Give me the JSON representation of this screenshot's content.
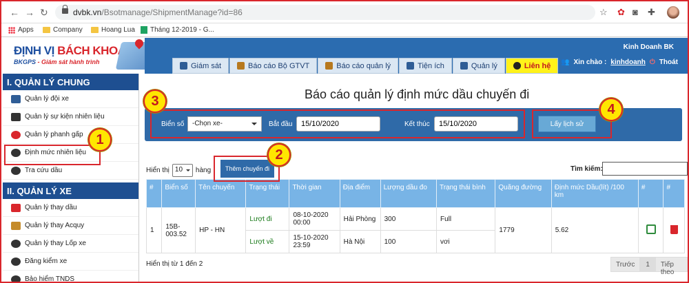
{
  "browser": {
    "url_host": "dvbk.vn",
    "url_path": "/Bsotmanage/ShipmentManage?id=86",
    "bookmarks": [
      "Apps",
      "Company",
      "Hoang Lua",
      "Tháng 12-2019 - G..."
    ]
  },
  "header": {
    "logo_main_1": "ĐỊNH VỊ ",
    "logo_main_2": "BÁCH KHOA",
    "logo_sub_1": "BKGPS",
    "logo_sub_2": " - Giám sát hành trình",
    "company": "Kinh Doanh BK",
    "greeting": "Xin chào :",
    "username": "kinhdoanh",
    "logout": "Thoát",
    "tabs": [
      "Giám sát",
      "Báo cáo Bộ GTVT",
      "Báo cáo quản lý",
      "Tiện ích",
      "Quản lý",
      "Liên hệ"
    ]
  },
  "sidebar": {
    "section1": "I. QUẢN LÝ CHUNG",
    "items1": [
      "Quản lý đội xe",
      "Quản lý sự kiện nhiên liệu",
      "Quản lý phanh gấp",
      "Định mức nhiên liệu",
      "Tra cứu dầu"
    ],
    "section2": "II. QUẢN LÝ XE",
    "items2": [
      "Quản lý thay dầu",
      "Quản lý thay Acquy",
      "Quản lý thay Lốp xe",
      "Đăng kiểm xe",
      "Bảo hiểm TNDS"
    ]
  },
  "main": {
    "title": "Báo cáo quản lý định mức dầu chuyến đi",
    "plate_label": "Biển số",
    "plate_value": "-Chọn xe-",
    "start_label": "Bắt đầu",
    "start_value": "15/10/2020",
    "end_label": "Kết thúc",
    "end_value": "15/10/2020",
    "history_button": "Lấy lịch sử",
    "show_label": "Hiển thị",
    "show_value": "10",
    "rows_label": "hàng",
    "add_button": "Thêm chuyến đi",
    "search_label": "Tìm kiếm:",
    "info": "Hiển thị từ 1 đến 2",
    "prev": "Trước",
    "page": "1",
    "next": "Tiếp theo"
  },
  "table": {
    "headers": [
      "#",
      "Biển số",
      "Tên chuyến",
      "Trạng thái",
      "Thời gian",
      "Địa điểm",
      "Lượng dầu đo",
      "Trạng thái bình",
      "Quãng đường",
      "Định mức Dầu(lít) /100 km",
      "#",
      "#"
    ],
    "row": {
      "index": "1",
      "plate": "15B-003.52",
      "route": "HP - HN",
      "distance": "1779",
      "norm": "5.62"
    },
    "legs": [
      {
        "status": "Lượt đi",
        "time": "08-10-2020 00:00",
        "place": "Hải Phòng",
        "fuel": "300",
        "tank": "Full"
      },
      {
        "status": "Lượt về",
        "time": "15-10-2020 23:59",
        "place": "Hà Nội",
        "fuel": "100",
        "tank": "vơi"
      }
    ]
  },
  "callouts": [
    "1",
    "2",
    "3",
    "4"
  ],
  "colors": {
    "primary": "#2f6aa8",
    "header_blue": "#1e4f91",
    "callout_border": "#d9262c",
    "callout_fill": "#ffe600",
    "active_tab": "#fff21a"
  }
}
